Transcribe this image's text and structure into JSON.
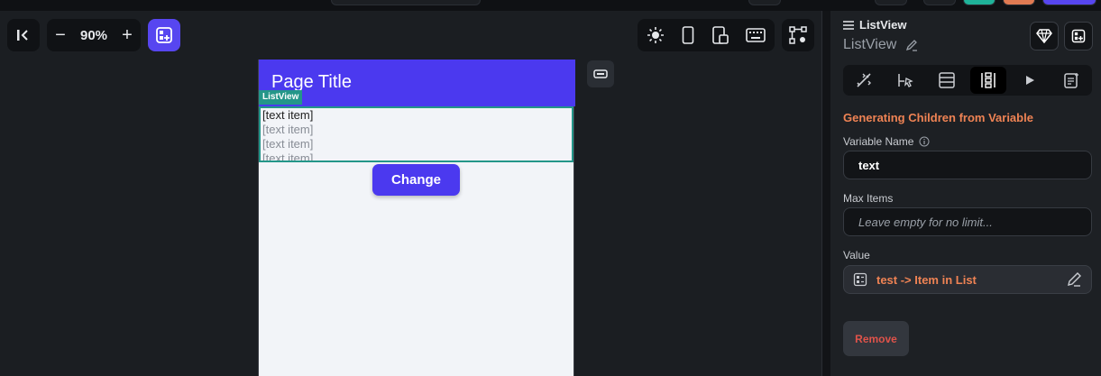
{
  "toolbar": {
    "zoom": "90%",
    "zoom_out": "−",
    "zoom_in": "+"
  },
  "phone": {
    "page_title": "Page Title",
    "listview_tag": "ListView",
    "list_items": [
      "[text item]",
      "[text item]",
      "[text item]",
      "[text item]"
    ],
    "button_label": "Change"
  },
  "panel": {
    "header": "ListView",
    "widget_name": "ListView",
    "section_title": "Generating Children from Variable",
    "variable_name_label": "Variable Name",
    "variable_name_value": "text",
    "max_items_label": "Max Items",
    "max_items_placeholder": "Leave empty for no limit...",
    "value_label": "Value",
    "value_text": "test -> Item in List",
    "remove_label": "Remove"
  },
  "colors": {
    "brand": "#4b39ef",
    "listview_outline": "#249689",
    "accent_orange": "#ef8354",
    "danger": "#e0534a"
  },
  "icons": [
    "collapse-panel-icon",
    "add-widget-icon",
    "light-mode-icon",
    "phone-icon",
    "tablet-icon",
    "keyboard-icon",
    "flow-icon",
    "hamburger-icon",
    "edit-pencil-icon",
    "gem-icon",
    "properties-icon",
    "actions-icon",
    "backend-icon",
    "generate-children-icon",
    "play-icon",
    "notes-icon",
    "info-icon",
    "variable-icon"
  ]
}
